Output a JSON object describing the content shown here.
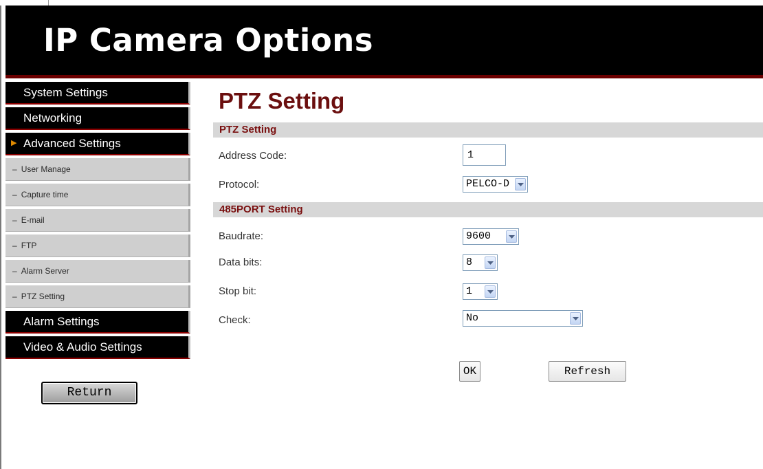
{
  "header": {
    "title": "IP Camera Options"
  },
  "sidebar": {
    "items": [
      {
        "label": "System Settings"
      },
      {
        "label": "Networking"
      },
      {
        "label": "Advanced Settings"
      },
      {
        "label": "User Manage"
      },
      {
        "label": "Capture time"
      },
      {
        "label": "E-mail"
      },
      {
        "label": "FTP"
      },
      {
        "label": "Alarm Server"
      },
      {
        "label": "PTZ Setting"
      },
      {
        "label": "Alarm Settings"
      },
      {
        "label": "Video & Audio Settings"
      }
    ],
    "return_label": "Return"
  },
  "main": {
    "page_title": "PTZ Setting",
    "sections": {
      "ptz": {
        "title": "PTZ Setting"
      },
      "port485": {
        "title": "485PORT Setting"
      }
    },
    "fields": {
      "address_code": {
        "label": "Address Code:",
        "value": "1"
      },
      "protocol": {
        "label": "Protocol:",
        "value": "PELCO-D"
      },
      "baudrate": {
        "label": "Baudrate:",
        "value": "9600"
      },
      "data_bits": {
        "label": "Data bits:",
        "value": "8"
      },
      "stop_bit": {
        "label": "Stop bit:",
        "value": "1"
      },
      "check": {
        "label": "Check:",
        "value": "No"
      }
    },
    "buttons": {
      "ok": "OK",
      "refresh": "Refresh"
    }
  },
  "colors": {
    "header_bg": "#000000",
    "accent_red": "#6b0f0f",
    "section_bg": "#d7d7d7",
    "submenu_bg": "#cfcfcf"
  },
  "icons": {
    "nav_arrow": "caret-right-icon",
    "dropdown": "chevron-down-icon"
  }
}
